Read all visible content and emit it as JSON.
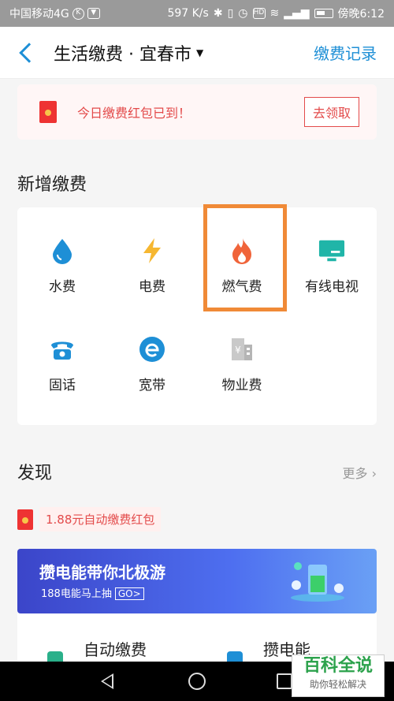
{
  "status_bar": {
    "carrier": "中国移动4G",
    "network_speed": "597 K/s",
    "time": "傍晚6:12"
  },
  "header": {
    "title": "生活缴费 · 宜春市",
    "right_link": "缴费记录"
  },
  "promo": {
    "text": "今日缴费红包已到！",
    "button": "去领取"
  },
  "new_payment": {
    "title": "新增缴费",
    "items": [
      {
        "label": "水费",
        "icon": "water-drop-icon"
      },
      {
        "label": "电费",
        "icon": "lightning-icon"
      },
      {
        "label": "燃气费",
        "icon": "flame-icon"
      },
      {
        "label": "有线电视",
        "icon": "tv-icon"
      },
      {
        "label": "固话",
        "icon": "telephone-icon"
      },
      {
        "label": "宽带",
        "icon": "broadband-icon"
      },
      {
        "label": "物业费",
        "icon": "property-icon"
      }
    ]
  },
  "discover": {
    "title": "发现",
    "more": "更多",
    "tag": "1.88元自动缴费红包",
    "banner_title": "攒电能带你北极游",
    "banner_sub": "188电能马上抽",
    "banner_go": "GO>",
    "bottom_items": [
      "自动缴费",
      "攒电能"
    ]
  },
  "watermark": {
    "title": "百科全说",
    "subtitle": "助你轻松解决"
  },
  "colors": {
    "accent": "#1e8fd6",
    "promo_red": "#e34b4b",
    "highlight": "#f08a37"
  }
}
